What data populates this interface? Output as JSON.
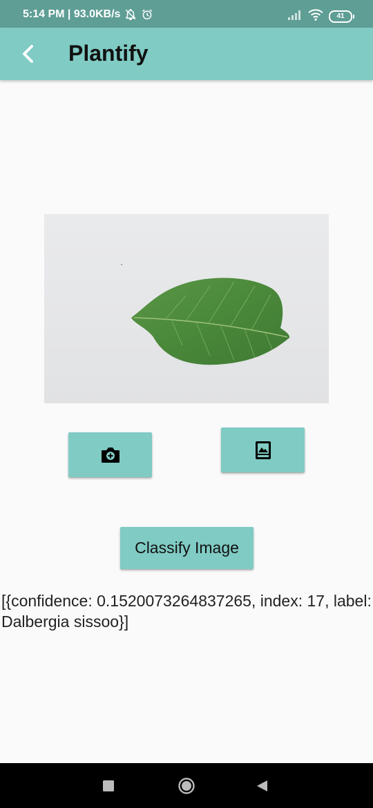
{
  "status_bar": {
    "time_and_speed": "5:14 PM | 93.0KB/s",
    "battery": "41",
    "icons": [
      "alarm-off-icon",
      "alarm-icon",
      "signal-icon",
      "wifi-icon",
      "battery-icon"
    ]
  },
  "app_bar": {
    "title": "Plantify",
    "back_icon": "back-arrow-icon",
    "background": "#80cbc4"
  },
  "main": {
    "camera_button_icon": "add-a-photo-icon",
    "gallery_button_icon": "photo-album-icon",
    "classify_label": "Classify Image",
    "result_text": "[{confidence: 0.1520073264837265, index: 17, label: Dalbergia sissoo}]"
  },
  "nav_bar": {
    "icons": [
      "recents-square-icon",
      "home-circle-icon",
      "back-triangle-icon"
    ]
  },
  "colors": {
    "accent": "#80cbc4",
    "status_bar": "#5f9e95"
  }
}
